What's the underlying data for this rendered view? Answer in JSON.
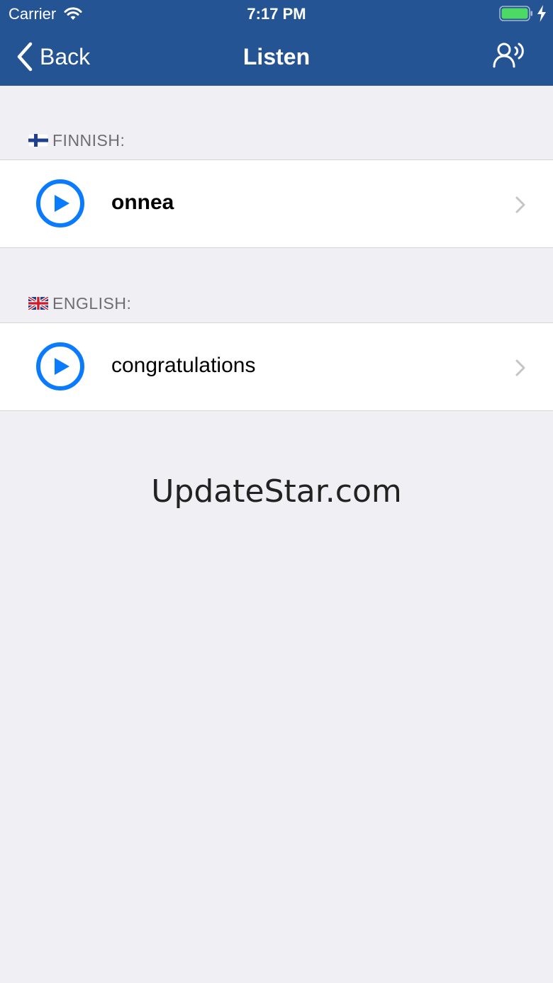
{
  "status_bar": {
    "carrier": "Carrier",
    "time": "7:17 PM",
    "battery_color": "#4cd964"
  },
  "nav": {
    "back_label": "Back",
    "title": "Listen",
    "right_icon": "speak-icon",
    "background": "#255494"
  },
  "sections": [
    {
      "flag": "finland-flag-icon",
      "header": "FINNISH:",
      "item": {
        "text": "onnea",
        "icon": "play-icon"
      }
    },
    {
      "flag": "uk-flag-icon",
      "header": "ENGLISH:",
      "item": {
        "text": "congratulations",
        "icon": "play-icon"
      }
    }
  ],
  "watermark": "UpdateStar.com",
  "accent_color": "#0a7aff"
}
